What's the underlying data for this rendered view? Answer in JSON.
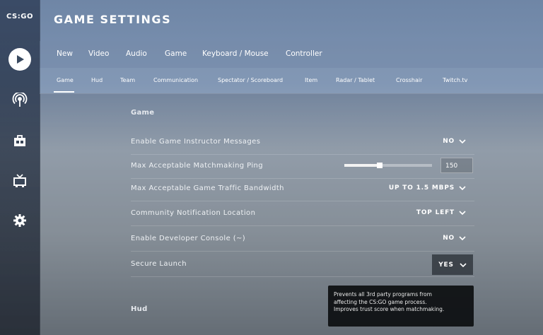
{
  "brand": {
    "logo": "CS:GO"
  },
  "header": {
    "title": "GAME SETTINGS"
  },
  "topnav": [
    {
      "label": "New"
    },
    {
      "label": "Video"
    },
    {
      "label": "Audio"
    },
    {
      "label": "Game"
    },
    {
      "label": "Keyboard / Mouse"
    },
    {
      "label": "Controller"
    }
  ],
  "subnav": [
    {
      "label": "Game"
    },
    {
      "label": "Hud"
    },
    {
      "label": "Team"
    },
    {
      "label": "Communication"
    },
    {
      "label": "Spectator / Scoreboard"
    },
    {
      "label": "Item"
    },
    {
      "label": "Radar / Tablet"
    },
    {
      "label": "Crosshair"
    },
    {
      "label": "Twitch.tv"
    }
  ],
  "sidebar_icons": [
    "play-icon",
    "broadcast-icon",
    "inventory-icon",
    "tv-icon",
    "gear-icon"
  ],
  "sections": {
    "game": "Game",
    "hud": "Hud"
  },
  "settings": [
    {
      "label": "Enable Game Instructor Messages",
      "value": "NO"
    },
    {
      "label": "Max Acceptable Matchmaking Ping",
      "value": "150",
      "slider_fraction": 0.4
    },
    {
      "label": "Max Acceptable Game Traffic Bandwidth",
      "value": "UP TO 1.5 MBPS"
    },
    {
      "label": "Community Notification Location",
      "value": "TOP LEFT"
    },
    {
      "label": "Enable Developer Console (~)",
      "value": "NO"
    },
    {
      "label": "Secure Launch",
      "value": "YES"
    }
  ],
  "tooltip": {
    "line1": "Prevents all 3rd party programs from",
    "line2": "affecting the CS:GO game process.",
    "line3": "Improves trust score when matchmaking."
  },
  "colors": {
    "accent": "#ffffff",
    "tooltip_bg": "#0c0e10"
  }
}
